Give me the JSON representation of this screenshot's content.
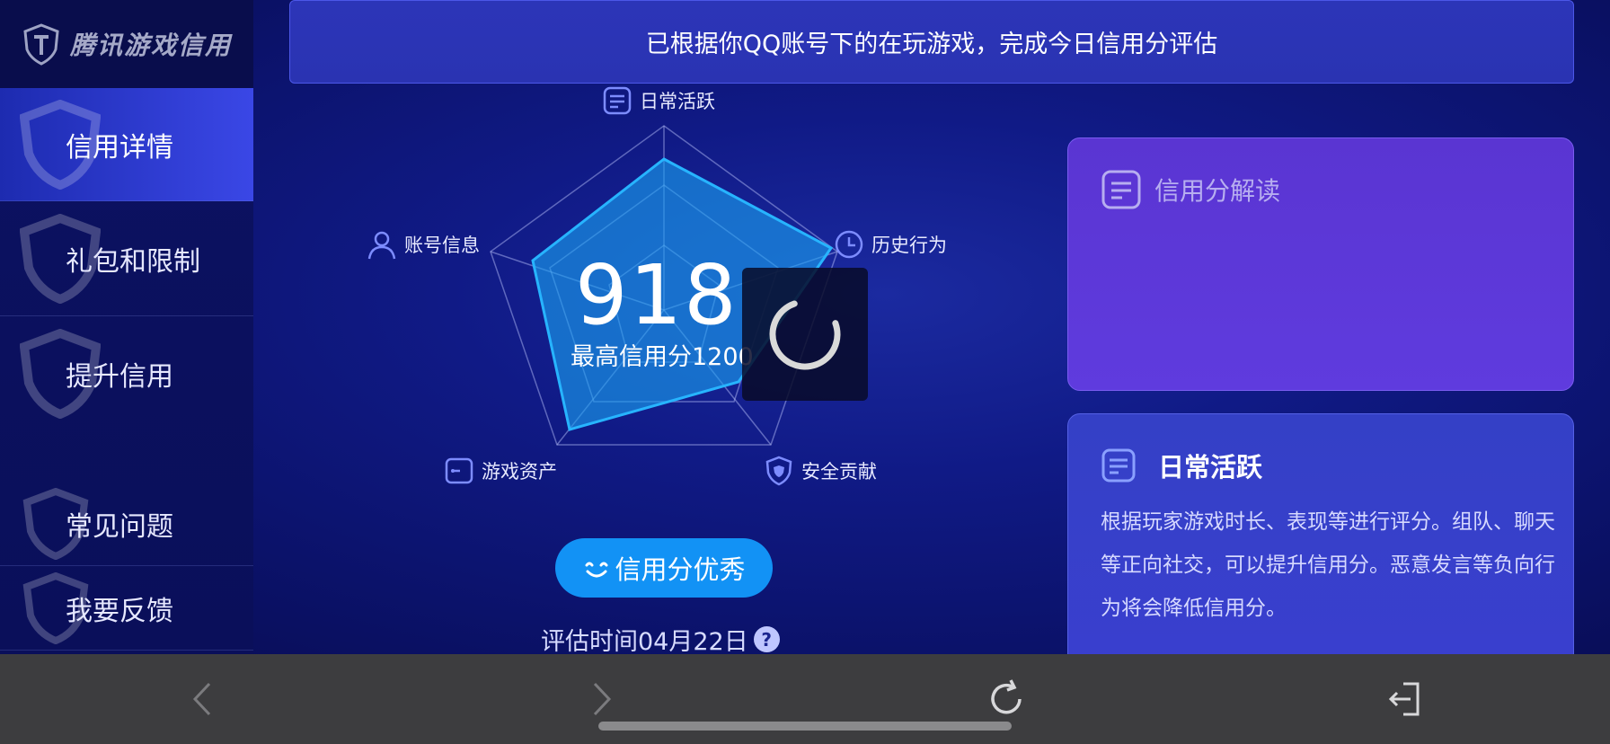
{
  "brand": {
    "name": "腾讯游戏信用"
  },
  "banner": {
    "text": "已根据你QQ账号下的在玩游戏，完成今日信用分评估"
  },
  "sidebar": {
    "items": [
      {
        "label": "信用详情",
        "active": true
      },
      {
        "label": "礼包和限制",
        "active": false
      },
      {
        "label": "提升信用",
        "active": false
      },
      {
        "label": "常见问题",
        "active": false
      },
      {
        "label": "我要反馈",
        "active": false
      }
    ]
  },
  "radar": {
    "axes": [
      {
        "label": "日常活跃",
        "icon": "document-icon"
      },
      {
        "label": "历史行为",
        "icon": "clock-icon"
      },
      {
        "label": "安全贡献",
        "icon": "shield-icon"
      },
      {
        "label": "游戏资产",
        "icon": "wallet-icon"
      },
      {
        "label": "账号信息",
        "icon": "user-icon"
      }
    ],
    "score": "918",
    "max_score_text": "最高信用分1200"
  },
  "rating": {
    "label": "信用分优秀"
  },
  "eval_time": {
    "text": "评估时间04月22日",
    "help": "?"
  },
  "card_interpret": {
    "title": "信用分解读"
  },
  "card_detail": {
    "title": "日常活跃",
    "body": "根据玩家游戏时长、表现等进行评分。组队、聊天等正向社交，可以提升信用分。恶意发言等负向行为将会降低信用分。"
  },
  "colors": {
    "accent": "#1292f5",
    "radar_fill": "#1aa0f0",
    "card_purple": "#5a35d2"
  }
}
